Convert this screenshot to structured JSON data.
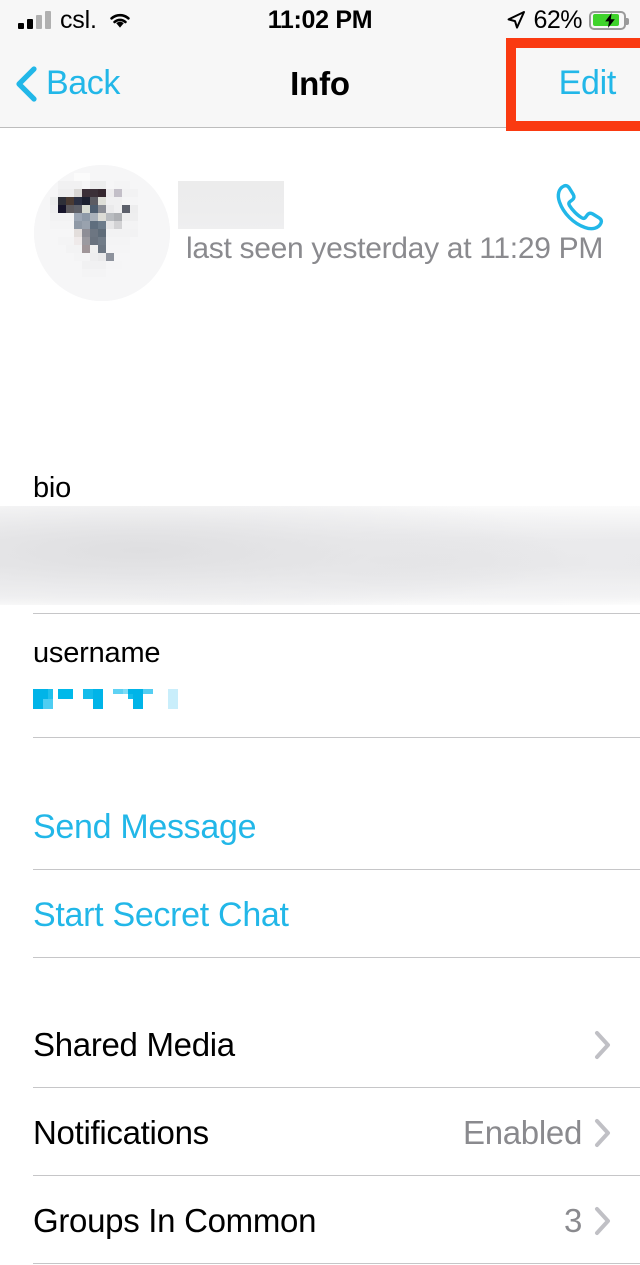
{
  "status_bar": {
    "carrier": "csl.",
    "time": "11:02 PM",
    "battery_percent": "62%",
    "signal_icon": "signal-bars-icon",
    "wifi_icon": "wifi-icon",
    "location_icon": "location-arrow-icon",
    "battery_icon": "battery-charging-icon"
  },
  "nav_bar": {
    "back_label": "Back",
    "title": "Info",
    "edit_label": "Edit",
    "back_icon": "chevron-left-icon",
    "highlight_color": "#FA3A11",
    "accent_color": "#22B7E8"
  },
  "profile": {
    "name": "",
    "name_redacted": true,
    "avatar": "contact-avatar-blurred",
    "last_seen": "last seen yesterday at 11:29 PM",
    "call_icon": "phone-call-icon"
  },
  "fields": [
    {
      "label": "bio",
      "value": "",
      "redacted": true
    },
    {
      "label": "username",
      "value": "",
      "redacted": true
    }
  ],
  "actions": [
    {
      "label": "Send Message",
      "name": "send-message"
    },
    {
      "label": "Start Secret Chat",
      "name": "start-secret-chat"
    }
  ],
  "settings": [
    {
      "label": "Shared Media",
      "value": "",
      "name": "shared-media"
    },
    {
      "label": "Notifications",
      "value": "Enabled",
      "name": "notifications"
    },
    {
      "label": "Groups In Common",
      "value": "3",
      "name": "groups-in-common"
    }
  ],
  "colors": {
    "accent": "#22B7E8",
    "highlight": "#FA3A11",
    "secondary_text": "#8A8A8E",
    "separator": "#C6C6C8",
    "bar_bg": "#F7F7F7"
  }
}
